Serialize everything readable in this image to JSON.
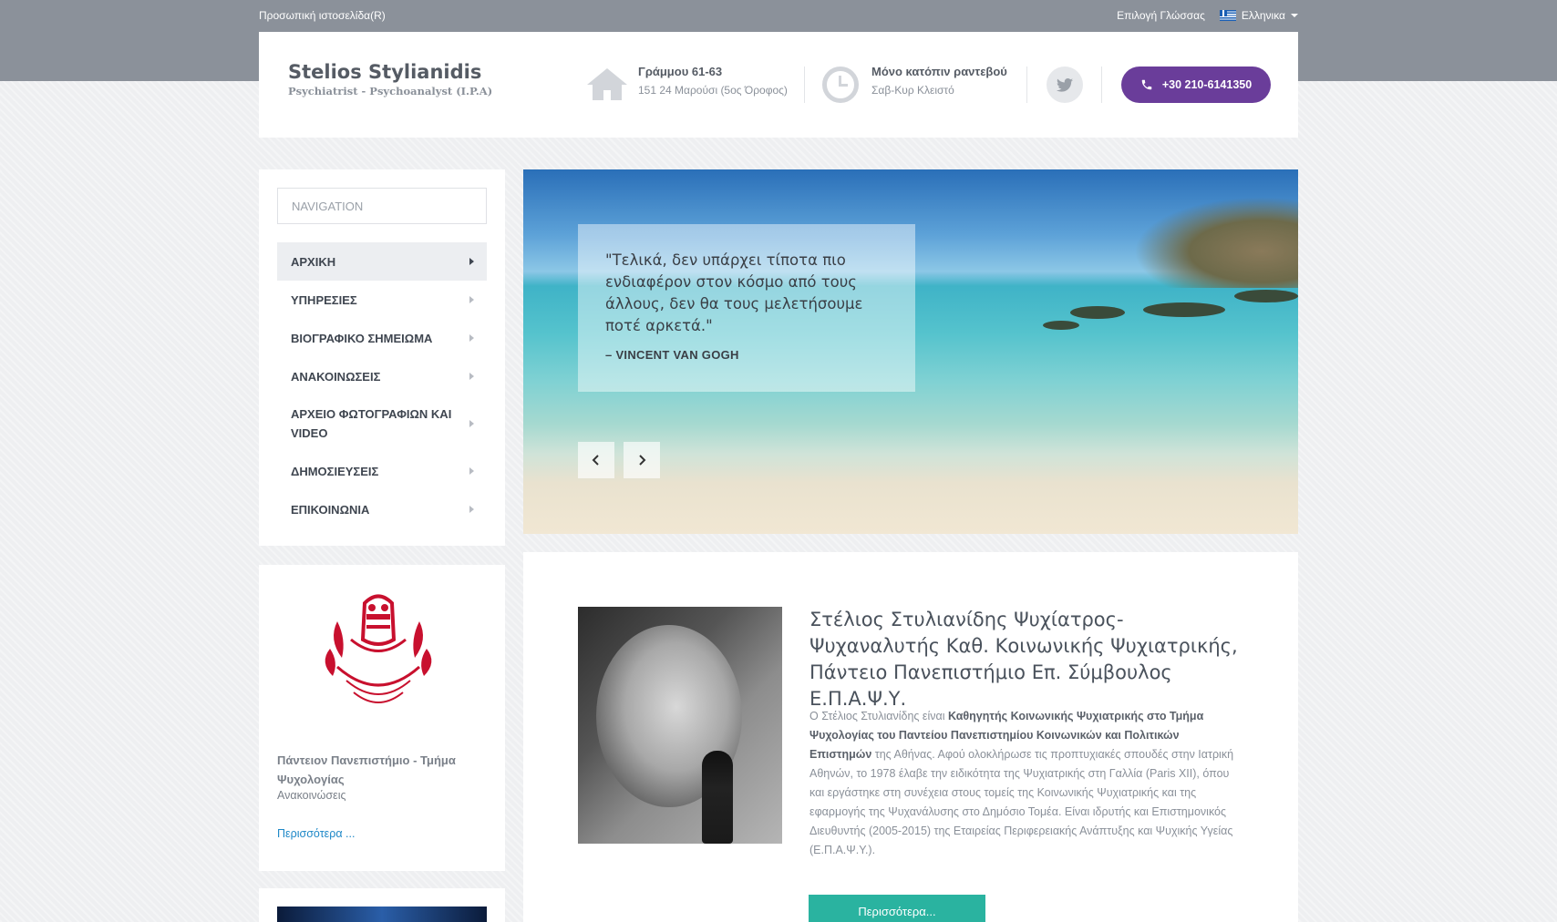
{
  "topbar": {
    "site_label": "Προσωπική ιστοσελίδα(R)",
    "lang_label": "Επιλογή Γλώσσας",
    "lang_value": "Ελληνικα"
  },
  "header": {
    "name": "Stelios Stylianidis",
    "tagline": "Psychiatrist - Psychoanalyst (I.P.A)",
    "address_title": "Γράμμου 61-63",
    "address_sub": "151 24 Μαρούσι (5ος Όροφος)",
    "hours_title": "Μόνο κατόπιν ραντεβού",
    "hours_sub": "Σαβ-Κυρ Κλειστό",
    "phone": "+30 210-6141350"
  },
  "sidebar": {
    "nav_placeholder": "NAVIGATION",
    "items": [
      {
        "label": "ΑΡΧΙΚΗ"
      },
      {
        "label": "ΥΠΗΡΕΣΙΕΣ"
      },
      {
        "label": "ΒΙΟΓΡΑΦΙΚΟ ΣΗΜΕΙΩΜΑ"
      },
      {
        "label": "ΑΝΑΚΟΙΝΩΣΕΙΣ"
      },
      {
        "label": "ΑΡΧΕΙΟ ΦΩΤΟΓΡΑΦΙΩΝ ΚΑΙ VIDEO"
      },
      {
        "label": "ΔΗΜΟΣΙΕΥΣΕΙΣ"
      },
      {
        "label": "ΕΠΙΚΟΙΝΩΝΙΑ"
      }
    ]
  },
  "slider": {
    "quote": "\"Τελικά, δεν υπάρχει τίποτα πιο ενδιαφέρον στον κόσμο από τους άλλους, δεν θα τους μελετήσουμε ποτέ αρκετά.\"",
    "author": "– VINCENT VAN GOGH"
  },
  "card": {
    "title": "Πάντειον Πανεπιστήμιο - Τμήμα Ψυχολογίας",
    "subtitle": "Ανακοινώσεις",
    "more": "Περισσότερα ..."
  },
  "main": {
    "title": "Στέλιος Στυλιανίδης Ψυχίατρος-Ψυχαναλυτής Καθ. Κοινωνικής Ψυχιατρικής, Πάντειο Πανεπιστήμιο Επ. Σύμβουλος Ε.Π.Α.Ψ.Υ.",
    "bio_intro": "Ο Στέλιος Στυλιανίδης είναι ",
    "bio_bold": "Καθηγητής Κοινωνικής Ψυχιατρικής στο Τμήμα Ψυχολογίας του Παντείου Πανεπιστημίου Κοινωνικών και Πολιτικών Επιστημών",
    "bio_rest": " της Αθήνας. Αφού ολοκλήρωσε τις προπτυχιακές σπουδές στην Ιατρική Αθηνών, το 1978 έλαβε την ειδικότητα της Ψυχιατρικής στη Γαλλία (Paris XII), όπου και εργάστηκε στη συνέχεια στους τομείς της Κοινωνικής Ψυχιατρικής και της εφαρμογής της Ψυχανάλυσης στο Δημόσιο Τομέα. Είναι ιδρυτής και Επιστημονικός Διευθυντής (2005-2015) της Εταιρείας Περιφερειακής Ανάπτυξης και Ψυχικής Υγείας (Ε.Π.Α.Ψ.Υ.).",
    "more_button": "Περισσότερα..."
  },
  "colors": {
    "accent": "#6a3d9a",
    "teal": "#2ab3a0",
    "link": "#1e88c7",
    "logo_red": "#c8102e"
  }
}
